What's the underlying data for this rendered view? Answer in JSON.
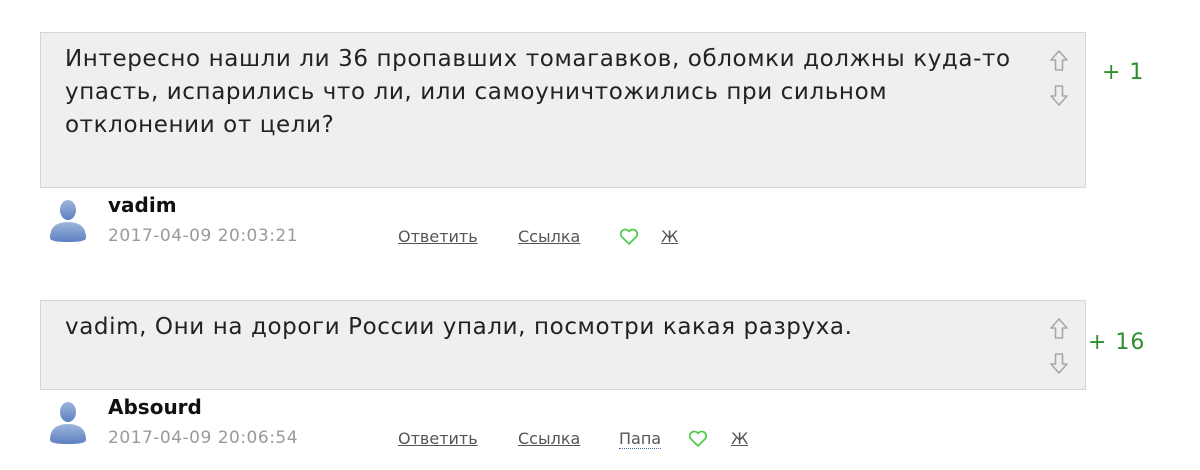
{
  "comments": [
    {
      "text": "Интересно нашли ли 36 пропавших томагавков, обломки должны куда-то упасть, испарились что ли, или самоуничтожились при сильном отклонении от цели?",
      "score": "+ 1",
      "author": "vadim",
      "timestamp": "2017-04-09 20:03:21",
      "actions": {
        "reply": "Ответить",
        "link": "Ссылка",
        "parent": "",
        "lj": "Ж"
      }
    },
    {
      "text": "vadim, Они на дороги России упали, посмотри какая разруха.",
      "score": "+ 16",
      "author": "Absourd",
      "timestamp": "2017-04-09 20:06:54",
      "actions": {
        "reply": "Ответить",
        "link": "Ссылка",
        "parent": "Папа",
        "lj": "Ж"
      }
    }
  ],
  "icons": {
    "upvote": "arrow-up-outline",
    "downvote": "arrow-down-outline",
    "like": "heart-outline",
    "avatar": "user-silhouette"
  },
  "colors": {
    "bubble_bg": "#efefef",
    "score": "#2f8f2f",
    "heart": "#4ccc4c",
    "timestamp": "#9a9a9a"
  }
}
